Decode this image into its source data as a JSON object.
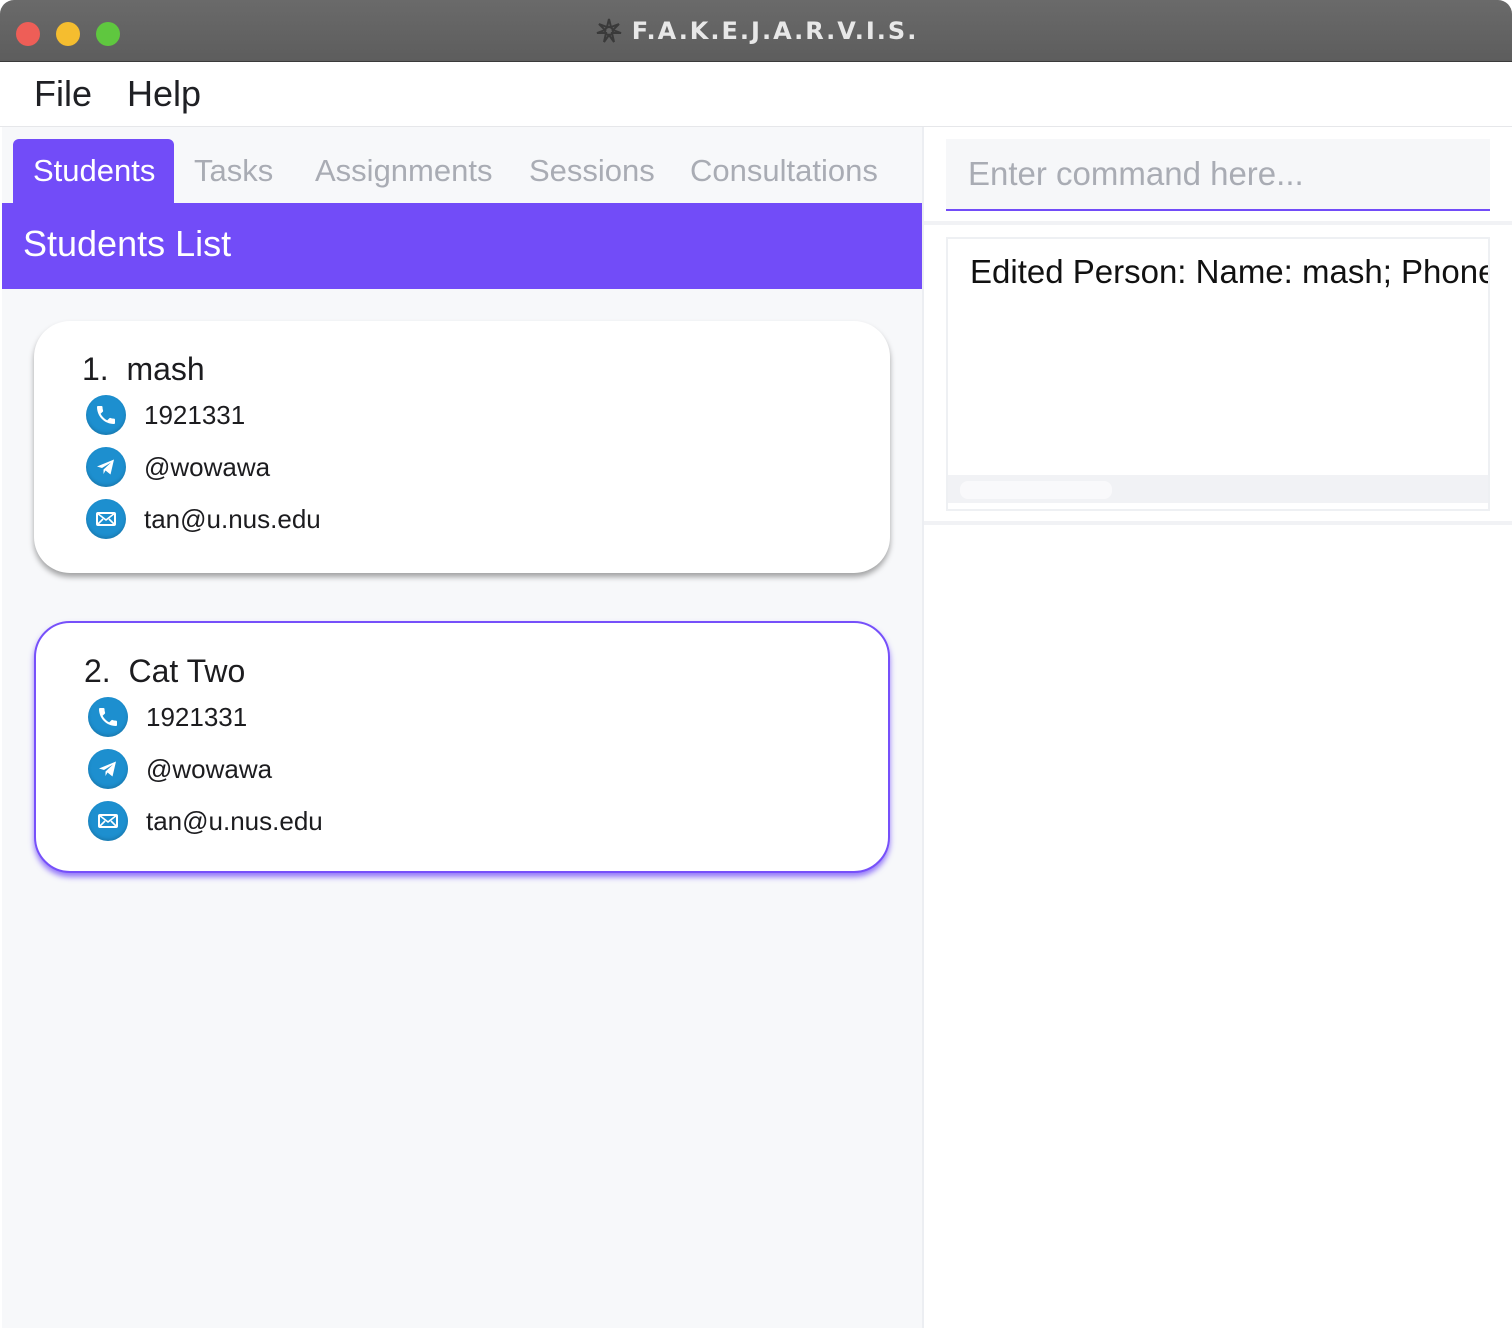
{
  "window": {
    "title": "F.A.K.E.J.A.R.V.I.S.",
    "traffic_lights": [
      "close",
      "minimize",
      "maximize"
    ]
  },
  "menu": {
    "file": "File",
    "help": "Help"
  },
  "tabs": [
    {
      "label": "Students",
      "active": true
    },
    {
      "label": "Tasks",
      "active": false
    },
    {
      "label": "Assignments",
      "active": false
    },
    {
      "label": "Sessions",
      "active": false
    },
    {
      "label": "Consultations",
      "active": false
    }
  ],
  "list": {
    "header": "Students List",
    "students": [
      {
        "index": "1.",
        "name": "mash",
        "phone": "1921331",
        "telegram": "@wowawa",
        "email": "tan@u.nus.edu",
        "selected": false
      },
      {
        "index": "2.",
        "name": "Cat Two",
        "phone": "1921331",
        "telegram": "@wowawa",
        "email": "tan@u.nus.edu",
        "selected": true
      }
    ]
  },
  "command": {
    "placeholder": "Enter command here...",
    "value": ""
  },
  "result": {
    "text": "Edited Person: Name: mash; Phone:"
  },
  "colors": {
    "accent": "#724cf8",
    "icon_blue": "#1d8fcf",
    "titlebar": "#626262",
    "tab_inactive_text": "#a9acb4"
  },
  "icons": {
    "phone": "phone-icon",
    "telegram": "telegram-icon",
    "email": "email-icon",
    "app": "app-logo-icon"
  }
}
